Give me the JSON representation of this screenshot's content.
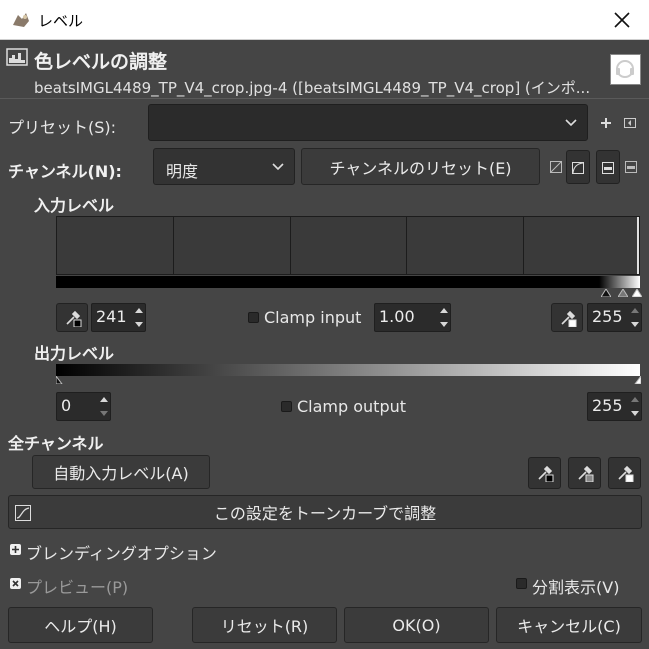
{
  "window": {
    "title": "レベル",
    "close_icon": "close-icon"
  },
  "header": {
    "title": "色レベルの調整",
    "subtitle": "beatsIMGL4489_TP_V4_crop.jpg-4 ([beatsIMGL4489_TP_V4_crop] (インポ..."
  },
  "presets": {
    "label": "プリセット(S):",
    "value": ""
  },
  "channel": {
    "label": "チャンネル(N):",
    "value": "明度",
    "reset_label": "チャンネルのリセット(E)"
  },
  "input_levels": {
    "heading": "入力レベル",
    "low_value": "241",
    "gamma_value": "1.00",
    "high_value": "255",
    "clamp_label": "Clamp input"
  },
  "output_levels": {
    "heading": "出力レベル",
    "low_value": "0",
    "high_value": "255",
    "clamp_label": "Clamp output"
  },
  "all_channels": {
    "heading": "全チャンネル",
    "auto_label": "自動入力レベル(A)"
  },
  "curves_button": "この設定をトーンカーブで調整",
  "blending": {
    "label": "ブレンディングオプション"
  },
  "preview": {
    "label": "プレビュー(P)",
    "split_label": "分割表示(V)"
  },
  "footer": {
    "help": "ヘルプ(H)",
    "reset": "リセット(R)",
    "ok": "OK(O)",
    "cancel": "キャンセル(C)"
  }
}
